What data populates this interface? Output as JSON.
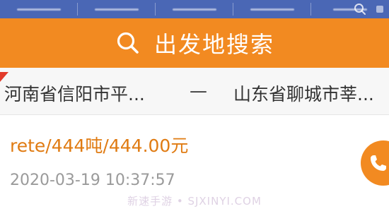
{
  "search_header": {
    "title": "出发地搜索",
    "icon": "search-icon",
    "background": "#f28a21"
  },
  "route": {
    "from": "河南省信阳市平...",
    "separator": "—",
    "to": "山东省聊城市莘..."
  },
  "record": {
    "price_text": "rete/444吨/444.00元",
    "timestamp": "2020-03-19 10:37:57",
    "price_color": "#e07b12"
  },
  "watermark": "新速手游 • SJXINYI.COM",
  "colors": {
    "accent": "#f28a21",
    "top_bar": "#4a67b5"
  }
}
